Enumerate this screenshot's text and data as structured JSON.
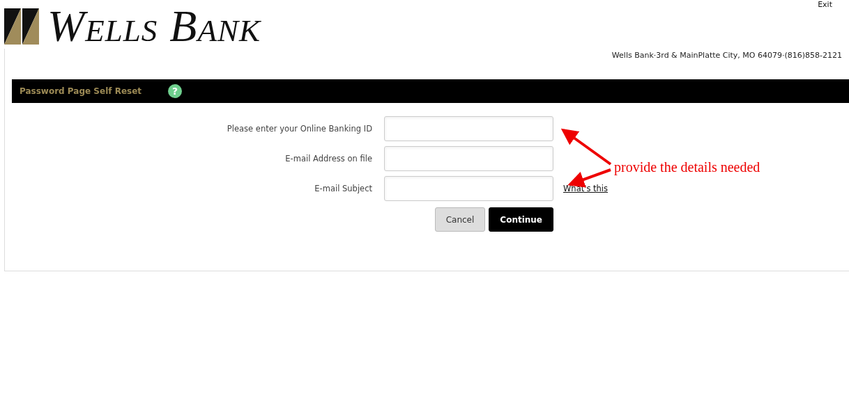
{
  "header": {
    "logo_text": "Wells Bank",
    "exit_link": "Exit",
    "address": "Wells Bank·3rd & MainPlatte City, MO 64079·(816)858-2121"
  },
  "title_bar": {
    "title": "Password Page Self Reset",
    "help_icon": "?"
  },
  "form": {
    "fields": [
      {
        "label": "Please enter your Online Banking ID"
      },
      {
        "label": "E-mail Address on file"
      },
      {
        "label": "E-mail Subject",
        "link": "What's this"
      }
    ],
    "buttons": [
      {
        "label": "Cancel",
        "kind": "secondary"
      },
      {
        "label": "Continue",
        "kind": "primary"
      }
    ]
  },
  "annotation": {
    "text": "provide the details needed"
  }
}
